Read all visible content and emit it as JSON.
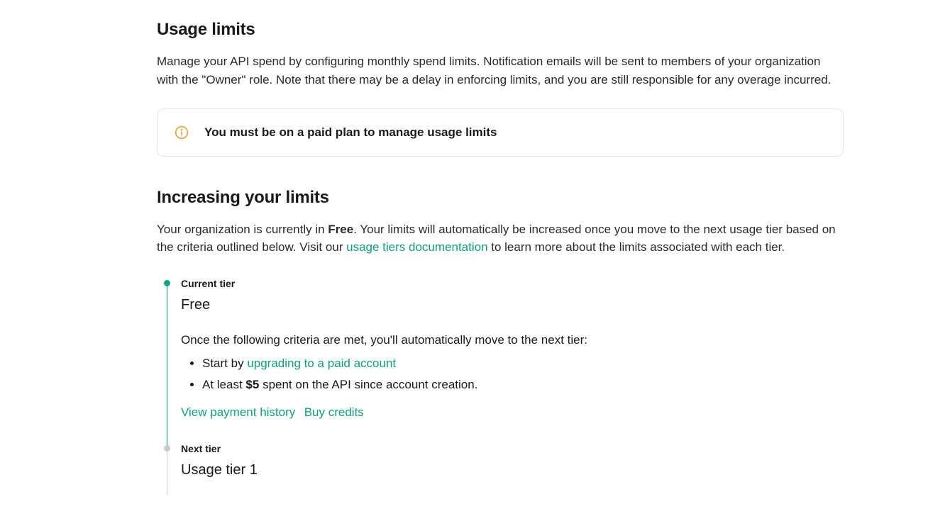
{
  "usage_limits": {
    "heading": "Usage limits",
    "description": "Manage your API spend by configuring monthly spend limits. Notification emails will be sent to members of your organization with the \"Owner\" role. Note that there may be a delay in enforcing limits, and you are still responsible for any overage incurred.",
    "alert": "You must be on a paid plan to manage usage limits"
  },
  "increasing": {
    "heading": "Increasing your limits",
    "desc_prefix": "Your organization is currently in ",
    "desc_tier": "Free",
    "desc_mid": ". Your limits will automatically be increased once you move to the next usage tier based on the criteria outlined below. Visit our ",
    "doc_link": "usage tiers documentation",
    "desc_suffix": " to learn more about the limits associated with each tier."
  },
  "current_tier": {
    "label": "Current tier",
    "name": "Free",
    "criteria_intro": "Once the following criteria are met, you'll automatically move to the next tier:",
    "criteria1_prefix": "Start by ",
    "criteria1_link": "upgrading to a paid account",
    "criteria2_prefix": "At least ",
    "criteria2_amount": "$5",
    "criteria2_suffix": " spent on the API since account creation.",
    "view_payment": "View payment history",
    "buy_credits": "Buy credits"
  },
  "next_tier": {
    "label": "Next tier",
    "name": "Usage tier 1"
  }
}
